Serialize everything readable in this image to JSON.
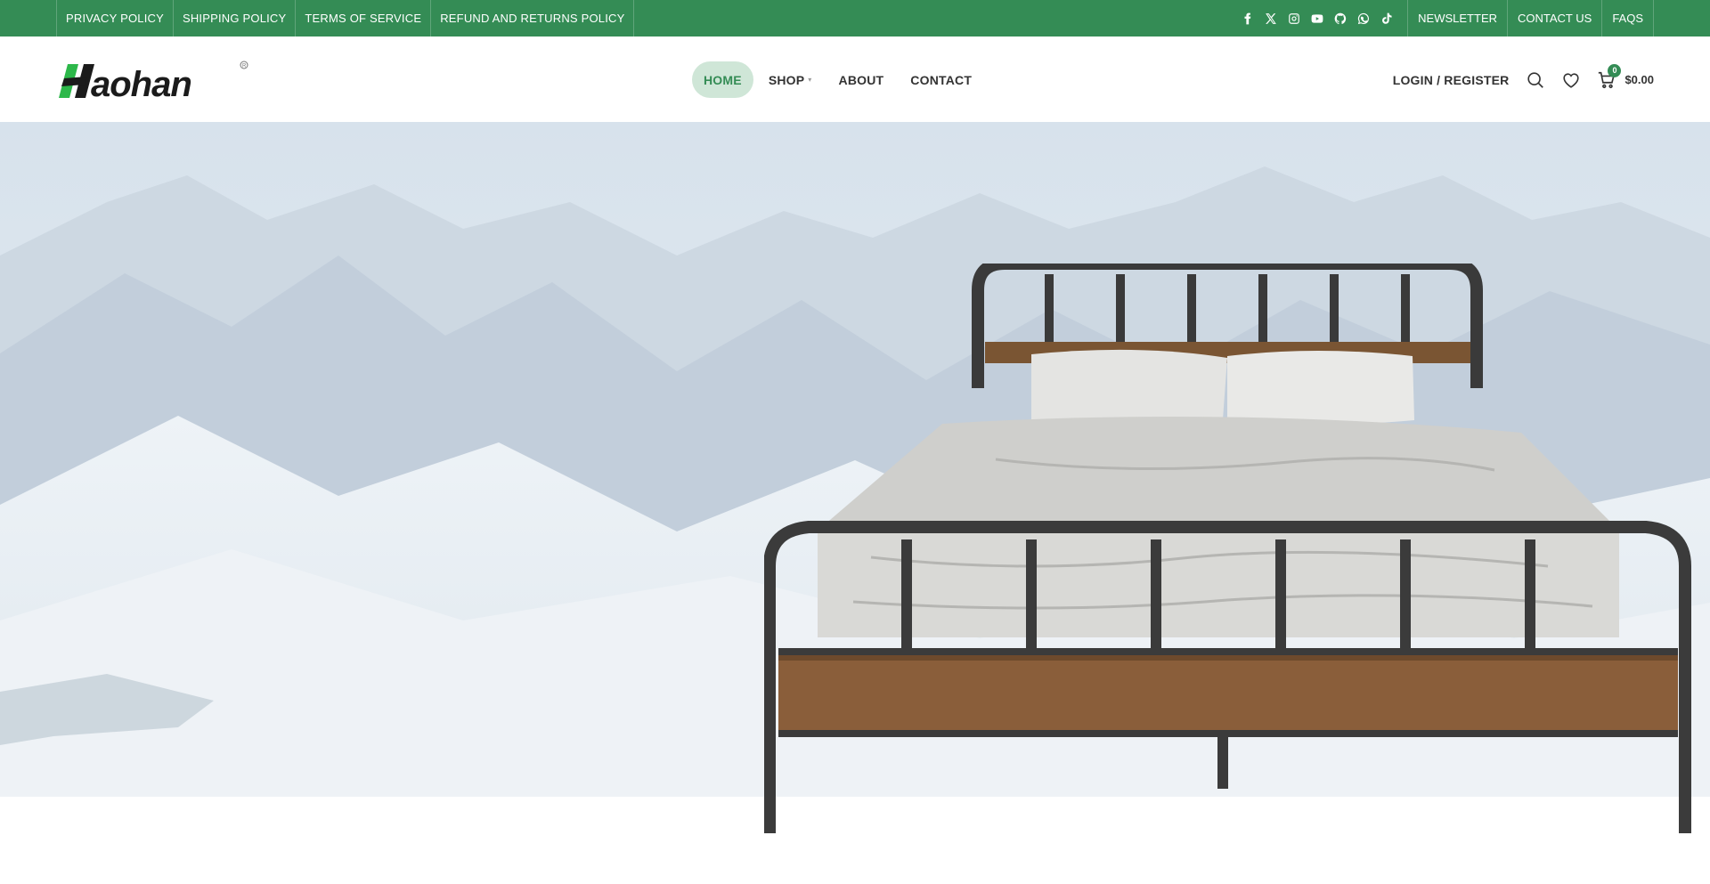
{
  "topbar": {
    "links": [
      "PRIVACY POLICY",
      "SHIPPING POLICY",
      "TERMS OF SERVICE",
      "REFUND AND RETURNS POLICY"
    ],
    "social_icons": [
      "facebook-icon",
      "x-twitter-icon",
      "instagram-icon",
      "youtube-icon",
      "github-icon",
      "whatsapp-icon",
      "tiktok-icon"
    ],
    "right_links": [
      "NEWSLETTER",
      "CONTACT US",
      "FAQS"
    ]
  },
  "header": {
    "logo_text": "Haohan",
    "nav": [
      {
        "label": "HOME",
        "active": true
      },
      {
        "label": "SHOP",
        "has_dropdown": true
      },
      {
        "label": "ABOUT"
      },
      {
        "label": "CONTACT"
      }
    ],
    "login_label": "LOGIN / REGISTER",
    "cart_count": "0",
    "cart_total": "$0.00"
  },
  "colors": {
    "brand_green": "#348c55",
    "active_pill": "#cfe6d7",
    "logo_green": "#2db84a",
    "text": "#333333"
  }
}
